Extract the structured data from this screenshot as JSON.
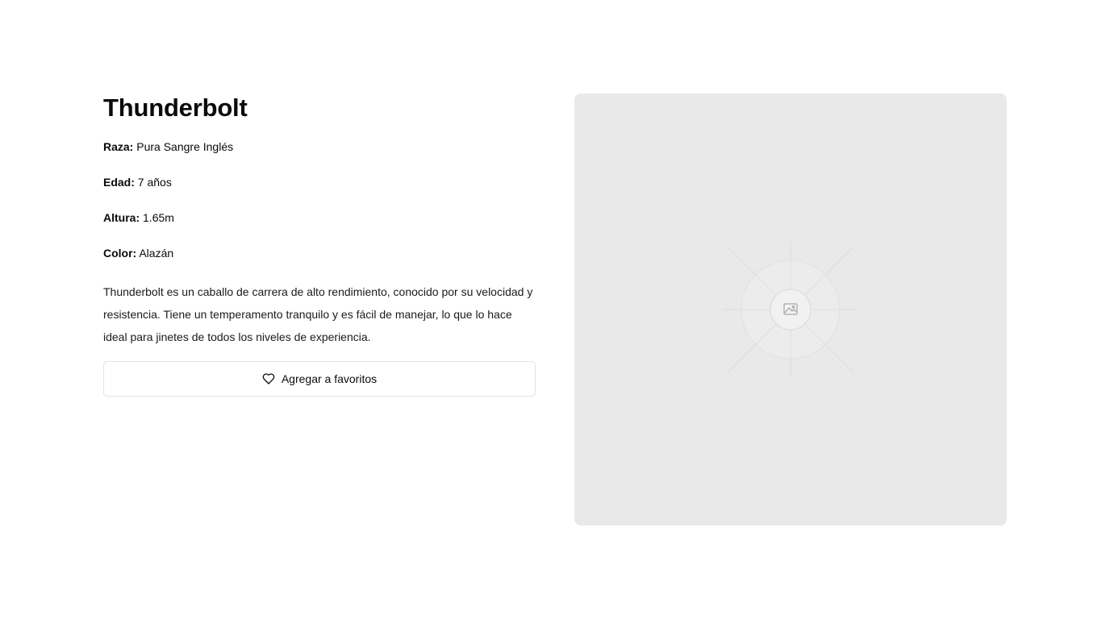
{
  "horse": {
    "name": "Thunderbolt",
    "attributes": {
      "breed": {
        "label": "Raza:",
        "value": "Pura Sangre Inglés"
      },
      "age": {
        "label": "Edad:",
        "value": "7 años"
      },
      "height": {
        "label": "Altura:",
        "value": "1.65m"
      },
      "color": {
        "label": "Color:",
        "value": "Alazán"
      }
    },
    "description": "Thunderbolt es un caballo de carrera de alto rendimiento, conocido por su velocidad y resistencia. Tiene un temperamento tranquilo y es fácil de manejar, lo que lo hace ideal para jinetes de todos los niveles de experiencia."
  },
  "actions": {
    "favorite_label": "Agregar a favoritos",
    "favorite_icon": "heart-icon"
  },
  "image": {
    "placeholder_icon": "image-placeholder-icon"
  },
  "colors": {
    "text": "#0a0a0a",
    "placeholder_bg": "#e9e9e9",
    "button_border": "#e3e3e3"
  }
}
